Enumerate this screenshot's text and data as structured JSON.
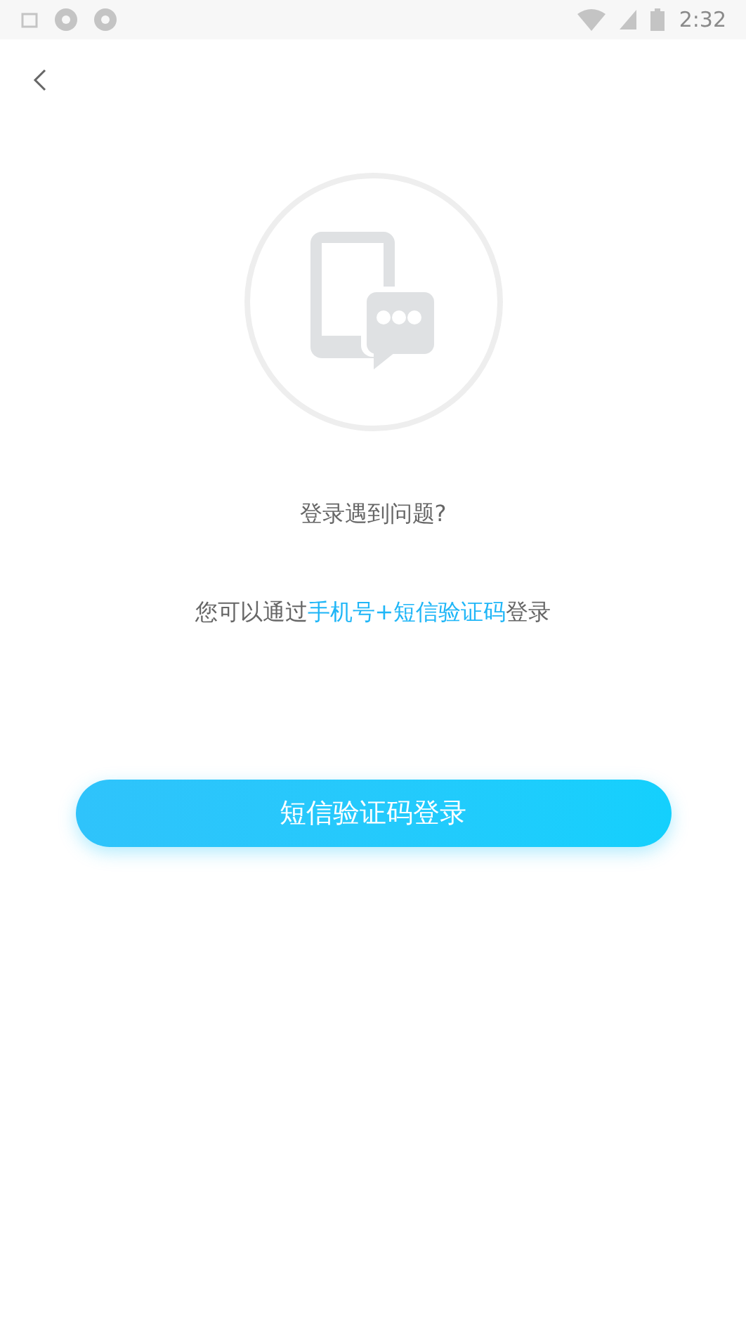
{
  "status_bar": {
    "time": "2:32"
  },
  "prompt": "登录遇到问题?",
  "hint": {
    "before": "您可以通过",
    "highlight": "手机号+短信验证码",
    "after": "登录"
  },
  "button": "短信验证码登录"
}
